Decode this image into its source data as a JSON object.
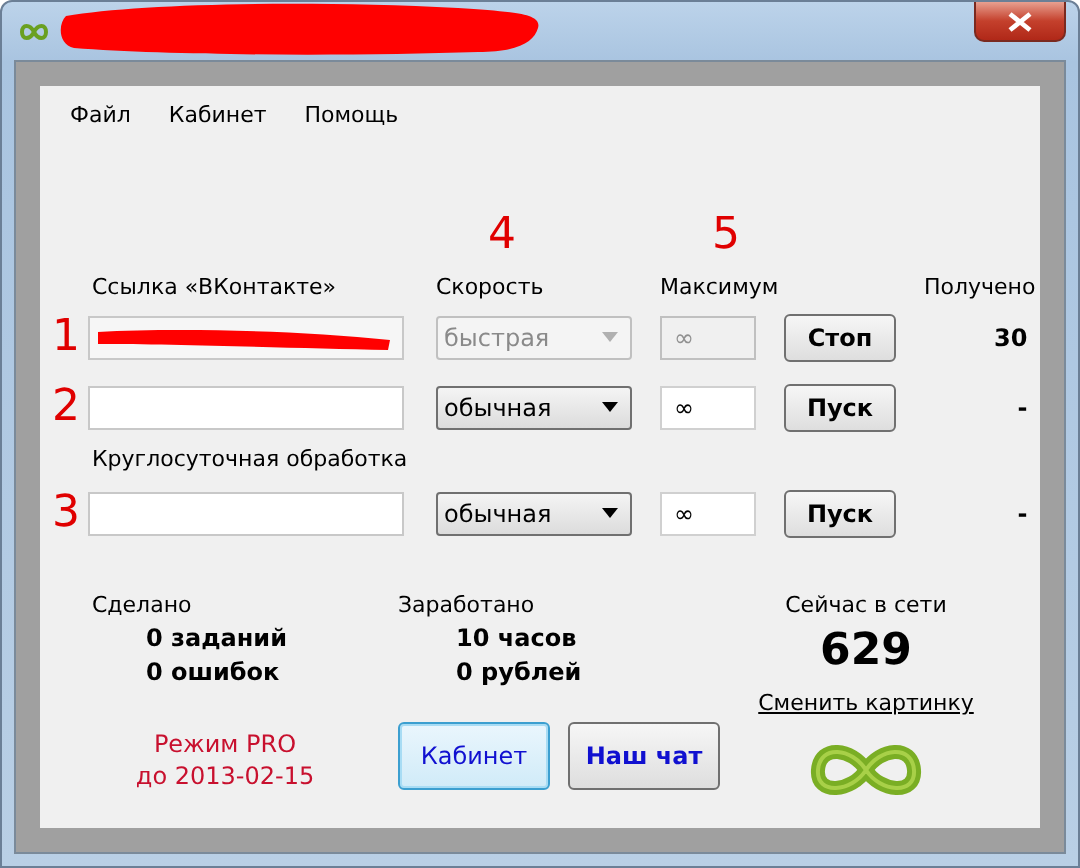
{
  "menu": [
    "Файл",
    "Кабинет",
    "Помощь"
  ],
  "columns": [
    {
      "label": "Ссылка «ВКонтакте»"
    },
    {
      "label": "Скорость",
      "marker": "4"
    },
    {
      "label": "Максимум",
      "marker": "5"
    },
    {
      "label": "Получено"
    }
  ],
  "tasks": [
    {
      "marker": "1",
      "redacted": true,
      "speed": "быстрая",
      "disabled": true,
      "max": "∞",
      "button": "Стоп",
      "received": "30"
    },
    {
      "marker": "2",
      "redacted": false,
      "speed": "обычная",
      "disabled": false,
      "max": "∞",
      "button": "Пуск",
      "received": "-"
    },
    {
      "marker": "3",
      "section_label": "Круглосуточная обработка",
      "redacted": false,
      "speed": "обычная",
      "disabled": false,
      "max": "∞",
      "button": "Пуск",
      "received": "-"
    }
  ],
  "stats": {
    "done": {
      "label": "Сделано",
      "lines": [
        "0 заданий",
        "0 ошибок"
      ]
    },
    "earned": {
      "label": "Заработано",
      "lines": [
        "10 часов",
        "0 рублей"
      ]
    },
    "online": {
      "label": "Сейчас в сети",
      "count": "629",
      "link": "Сменить картинку"
    }
  },
  "pro": [
    "Режим PRO",
    "до 2013-02-15"
  ],
  "buttons": [
    {
      "label": "Кабинет",
      "focused": true,
      "bold": false
    },
    {
      "label": "Наш чат",
      "focused": false,
      "bold": true
    }
  ]
}
